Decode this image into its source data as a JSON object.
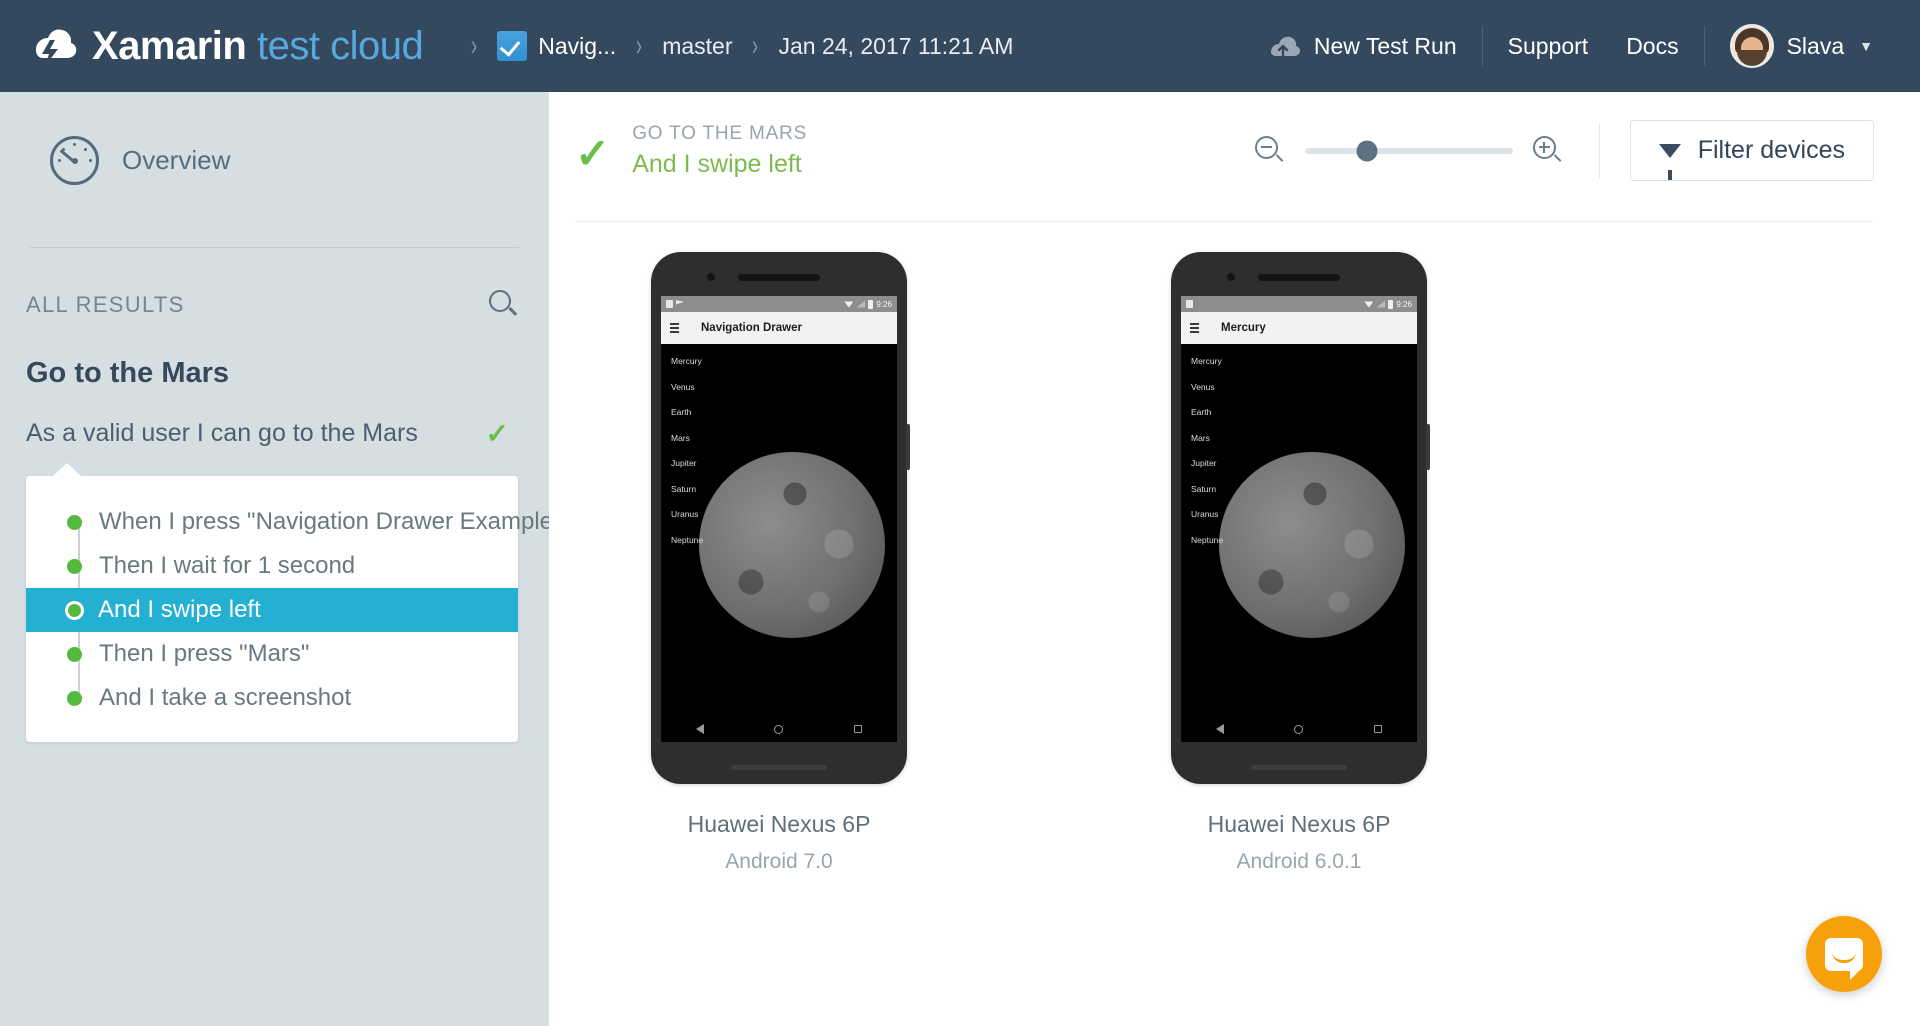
{
  "header": {
    "brand_main": "Xamarin",
    "brand_sub": "test cloud",
    "breadcrumbs": [
      {
        "label": "Navig...",
        "icon": "test-run-icon"
      },
      {
        "label": "master",
        "icon": null
      },
      {
        "label": "Jan 24, 2017 11:21 AM",
        "icon": null
      }
    ],
    "separator": "›",
    "new_test_run": "New Test Run",
    "support": "Support",
    "docs": "Docs",
    "user_name": "Slava",
    "caret": "▼"
  },
  "sidebar": {
    "overview_label": "Overview",
    "all_results_label": "ALL RESULTS",
    "search_icon": "search-icon",
    "feature_title": "Go to the Mars",
    "scenario_label": "As a valid user I can go to the Mars",
    "scenario_status_icon": "✓",
    "steps": [
      {
        "label": "When I press \"Navigation Drawer Example\"",
        "active": false
      },
      {
        "label": "Then I wait for 1 second",
        "active": false
      },
      {
        "label": "And I swipe left",
        "active": true
      },
      {
        "label": "Then I press \"Mars\"",
        "active": false
      },
      {
        "label": "And I take a screenshot",
        "active": false
      }
    ]
  },
  "main": {
    "status_icon": "✓",
    "eyebrow": "GO TO THE MARS",
    "title": "And I swipe left",
    "zoom_out_icon": "zoom-out-icon",
    "zoom_in_icon": "zoom-in-icon",
    "zoom_value": 30,
    "filter_label": "Filter devices",
    "devices": [
      {
        "name": "Huawei Nexus 6P",
        "os": "Android 7.0",
        "screen": {
          "app_title": "Navigation Drawer",
          "status_time": "9:26",
          "planets": [
            "Mercury",
            "Venus",
            "Earth",
            "Mars",
            "Jupiter",
            "Saturn",
            "Uranus",
            "Neptune"
          ]
        }
      },
      {
        "name": "Huawei Nexus 6P",
        "os": "Android 6.0.1",
        "screen": {
          "app_title": "Mercury",
          "status_time": "9:26",
          "planets": [
            "Mercury",
            "Venus",
            "Earth",
            "Mars",
            "Jupiter",
            "Saturn",
            "Uranus",
            "Neptune"
          ]
        }
      }
    ]
  },
  "chat": {
    "icon": "chat-bubble-icon"
  },
  "colors": {
    "topbar": "#34495e",
    "brand_accent": "#57a8e0",
    "sidebar": "#d5dee1",
    "active_step": "#23b0d3",
    "pass_green": "#6abf4b",
    "dot_green": "#53ba3e",
    "intercom": "#f7a10a"
  }
}
